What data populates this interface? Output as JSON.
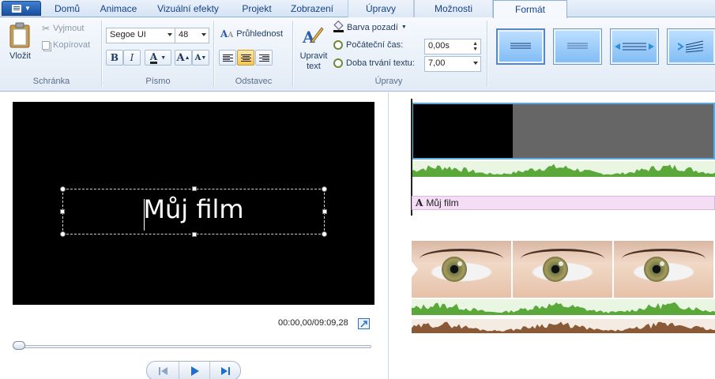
{
  "tabs": {
    "home": "Domů",
    "animations": "Animace",
    "visual_effects": "Vizuální efekty",
    "project": "Projekt",
    "view": "Zobrazení",
    "edit": "Úpravy",
    "options": "Možnosti",
    "format": "Formát"
  },
  "clipboard": {
    "paste": "Vložit",
    "cut": "Vyjmout",
    "copy": "Kopírovat",
    "group": "Schránka"
  },
  "font": {
    "family": "Segoe UI",
    "size": "48",
    "bold": "B",
    "italic": "I",
    "color_letter": "A",
    "grow": "A",
    "shrink": "A",
    "group": "Písmo"
  },
  "paragraph": {
    "transparency": "Průhlednost",
    "group": "Odstavec",
    "selected_alignment": "center"
  },
  "adjust": {
    "edit_text_line1": "Upravit",
    "edit_text_line2": "text",
    "background_color": "Barva pozadí",
    "start_time_label": "Počáteční čas:",
    "start_time_value": "0,00s",
    "duration_label": "Doba trvání textu:",
    "duration_value": "7,00",
    "group": "Úpravy"
  },
  "preview": {
    "title_text": "Můj film",
    "timecode": "00:00,00/09:09,28",
    "progress": 0.0
  },
  "storyboard": {
    "caption_icon": "A",
    "caption_text": "Můj film"
  },
  "colors": {
    "ribbon_bg": "#e2ebf6",
    "accent_blue": "#5da9dd",
    "caption_bg": "#f5ddf6",
    "waveform_green": "#5aa83a",
    "waveform_brown": "#8a5a36"
  }
}
